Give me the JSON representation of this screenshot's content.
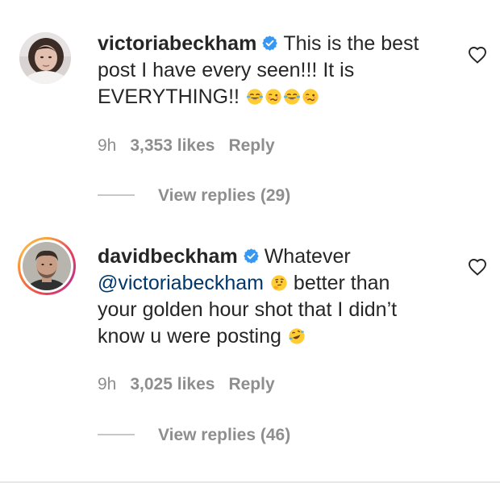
{
  "comments": [
    {
      "username": "victoriabeckham",
      "verified": true,
      "text": "This is the best post I have every seen!!! It is EVERYTHING!!",
      "emojis": [
        "face-with-tears-of-joy",
        "woozy-face",
        "face-with-tears-of-joy",
        "woozy-face"
      ],
      "time": "9h",
      "likes": "3,353 likes",
      "reply_label": "Reply",
      "view_replies": "View replies (29)",
      "avatar_ring": false
    },
    {
      "username": "davidbeckham",
      "verified": true,
      "mention": "@victoriabeckham",
      "text_after_mention": "better than your golden hour shot that I didn’t know u were posting",
      "emojis": [
        "thinking-face",
        "rolling-on-the-floor-laughing"
      ],
      "time": "9h",
      "likes": "3,025 likes",
      "reply_label": "Reply",
      "view_replies": "View replies (46)",
      "avatar_ring": true,
      "text_prefix": "Whatever"
    }
  ],
  "colors": {
    "text": "#262626",
    "secondary": "#8e8e8e",
    "verified": "#3897f0",
    "mention": "#00376b",
    "story_ring": [
      "#fcaf45",
      "#e4405f",
      "#c13584"
    ]
  },
  "icons": {
    "verified": "verified-badge-icon",
    "like": "heart-outline-icon"
  }
}
